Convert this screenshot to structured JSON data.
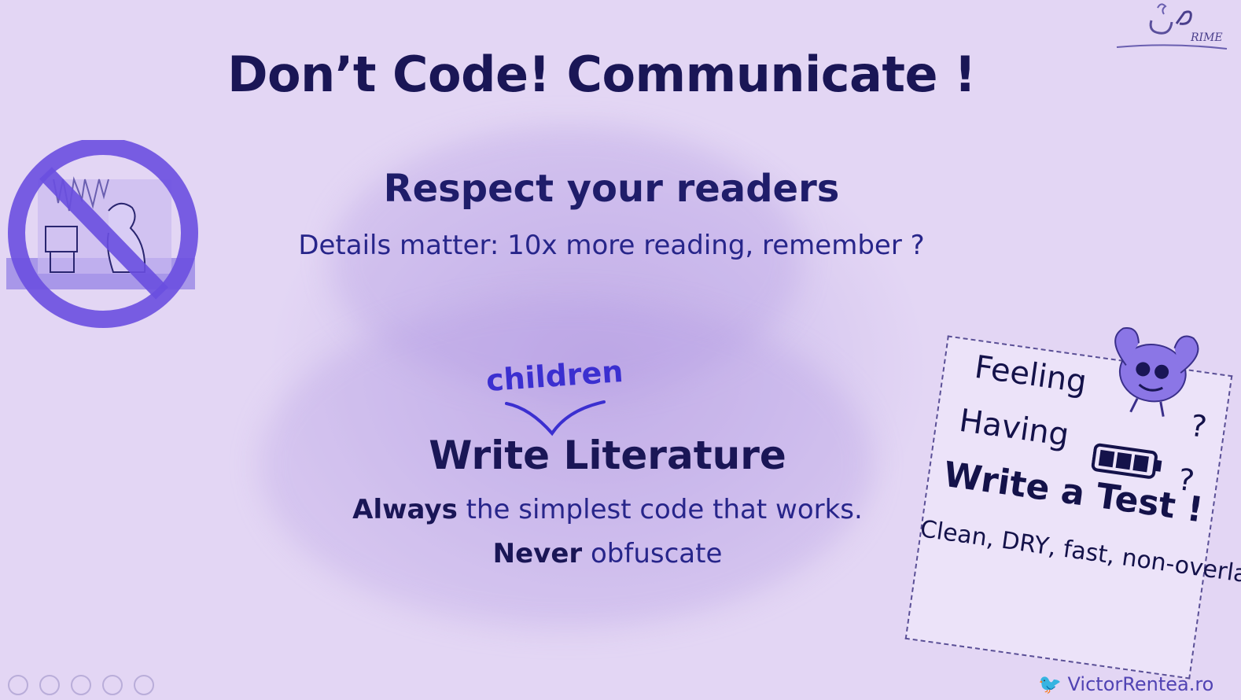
{
  "slide": {
    "title": "Don’t Code! Communicate !",
    "subtitle": "Respect your readers",
    "details": "Details matter: 10x more reading, remember ?",
    "annotation": "children",
    "write_literature": "Write Literature",
    "line1_bold": "Always",
    "line1_rest": " the simplest code that works.",
    "line2_bold": "Never",
    "line2_rest": " obfuscate"
  },
  "note": {
    "feeling": "Feeling",
    "having": "Having",
    "question1": "?",
    "question2": "?",
    "write_test": "Write a Test !",
    "criteria": "Clean, DRY, fast,\nnon-overlapping,\nsignificant"
  },
  "footer": {
    "handle": "VictorRentea.ro"
  },
  "icons": {
    "no_code": "prohibition-sign-icon",
    "logo": "j-prime-logo",
    "twitter": "twitter-bird-icon",
    "battery": "battery-full-icon",
    "brain": "muscular-brain-icon"
  },
  "colors": {
    "background": "#e3d6f4",
    "title": "#1a1656",
    "accent": "#3b2fd0",
    "prohibition": "#6a4fe0"
  }
}
